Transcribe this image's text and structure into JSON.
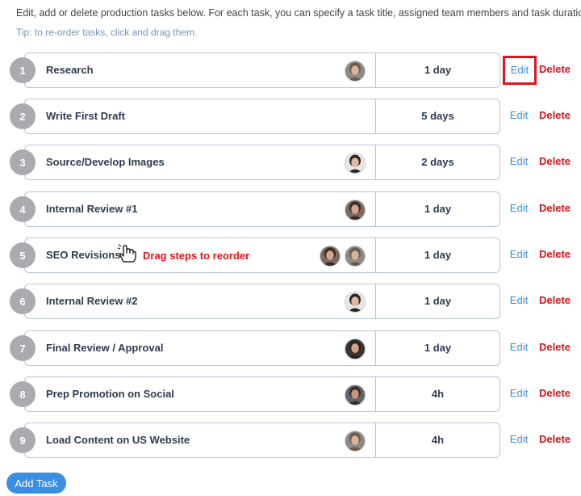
{
  "intro": "Edit, add or delete production tasks below. For each task, you can specify a task title, assigned team members and task duration.",
  "tip": "Tip: to re-order tasks, click and drag them.",
  "drag_hint": "Drag steps to reorder",
  "edit_label": "Edit",
  "delete_label": "Delete",
  "add_task_label": "Add Task",
  "tasks": [
    {
      "num": "1",
      "title": "Research",
      "duration": "1 day",
      "avatars": [
        "woman-gray"
      ]
    },
    {
      "num": "2",
      "title": "Write First Draft",
      "duration": "5 days",
      "avatars": []
    },
    {
      "num": "3",
      "title": "Source/Develop Images",
      "duration": "2 days",
      "avatars": [
        "man-dark"
      ]
    },
    {
      "num": "4",
      "title": "Internal Review #1",
      "duration": "1 day",
      "avatars": [
        "woman-brown"
      ]
    },
    {
      "num": "5",
      "title": "SEO Revisions",
      "duration": "1 day",
      "avatars": [
        "woman-brown",
        "woman-gray"
      ]
    },
    {
      "num": "6",
      "title": "Internal Review #2",
      "duration": "1 day",
      "avatars": [
        "man-dark"
      ]
    },
    {
      "num": "7",
      "title": "Final Review / Approval",
      "duration": "1 day",
      "avatars": [
        "man-bald"
      ]
    },
    {
      "num": "8",
      "title": "Prep Promotion on Social",
      "duration": "4h",
      "avatars": [
        "man-glasses"
      ]
    },
    {
      "num": "9",
      "title": "Load Content on US Website",
      "duration": "4h",
      "avatars": [
        "woman-gray"
      ]
    }
  ]
}
